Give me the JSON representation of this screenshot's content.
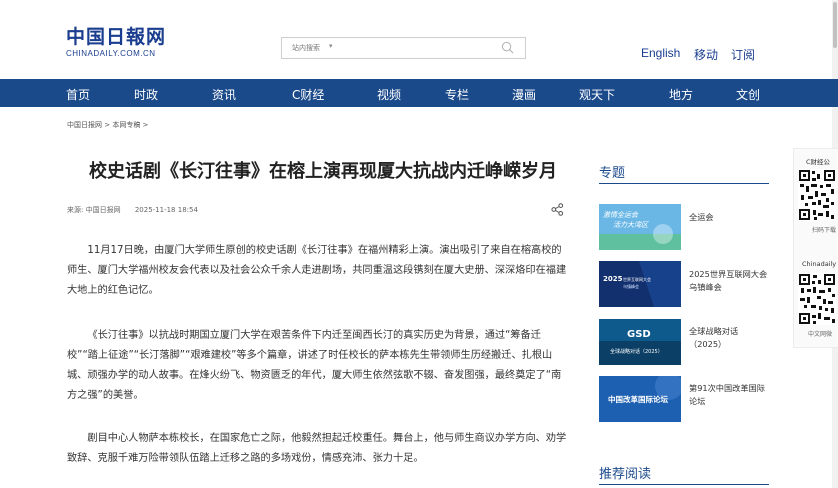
{
  "header": {
    "logo_text": "中国日報网",
    "logo_domain": "CHINADAILY.COM.CN",
    "search_scope": "站内搜索",
    "search_value": "",
    "links": [
      "English",
      "移动",
      "订阅"
    ]
  },
  "nav": [
    "首页",
    "时政",
    "资讯",
    "C财经",
    "视频",
    "专栏",
    "漫画",
    "观天下",
    "地方",
    "文创"
  ],
  "breadcrumb": "中国日报网 > 本网专稿 >",
  "article": {
    "title": "校史话剧《长汀往事》在榕上演再现厦大抗战内迁峥嵘岁月",
    "source": "来源:  中国日报网",
    "date": "2025-11-18 18:54",
    "paragraphs": [
      "11月17日晚，由厦门大学师生原创的校史话剧《长汀往事》在福州精彩上演。演出吸引了来自在榕高校的师生、厦门大学福州校友会代表以及社会公众千余人走进剧场，共同重温这段镌刻在厦大史册、深深烙印在福建大地上的红色记忆。",
      "《长汀往事》以抗战时期国立厦门大学在艰苦条件下内迁至闽西长汀的真实历史为背景，通过“筹备迁校”“踏上征途”“长汀落脚”“艰难建校”等多个篇章，讲述了时任校长的萨本栋先生带领师生历经搬迁、扎根山城、顽强办学的动人故事。在烽火纷飞、物资匮乏的年代，厦大师生依然弦歌不辍、奋发图强，最终奠定了“南方之强”的美誉。",
      "剧目中心人物萨本栋校长，在国家危亡之际，他毅然担起迁校重任。舞台上，他与师生商议办学方向、劝学致辞、克服千难万险带领队伍踏上迁移之路的多场戏份，情感充沛、张力十足。"
    ]
  },
  "sidebar": {
    "topics_title": "专题",
    "topics": [
      {
        "label": "全运会",
        "thumb_text": "激情全运会 活力大湾区",
        "thumb_color": "#6ab7e6"
      },
      {
        "label": "2025世界互联网大会乌镇峰会",
        "thumb_text": "2025 WORLD INTERNET CONFERENCE",
        "thumb_color": "#12306e"
      },
      {
        "label": "全球战略对话（2025）",
        "thumb_text": "GSD 全球战略对话（2025）",
        "thumb_color": "#0f5a8c"
      },
      {
        "label": "第91次中国改革国际论坛",
        "thumb_text": "中国改革国际论坛",
        "thumb_color": "#1d5fb0"
      }
    ],
    "recommend_title": "推荐阅读"
  },
  "qr": {
    "c_finance_caption": "C财经公",
    "c_finance_sub": "扫码下载",
    "chinadaily_caption": "Chinadaily",
    "chinadaily_sub": "中文网微"
  },
  "colors": {
    "brand": "#1b4a8b",
    "logo": "#1a3d8f"
  }
}
